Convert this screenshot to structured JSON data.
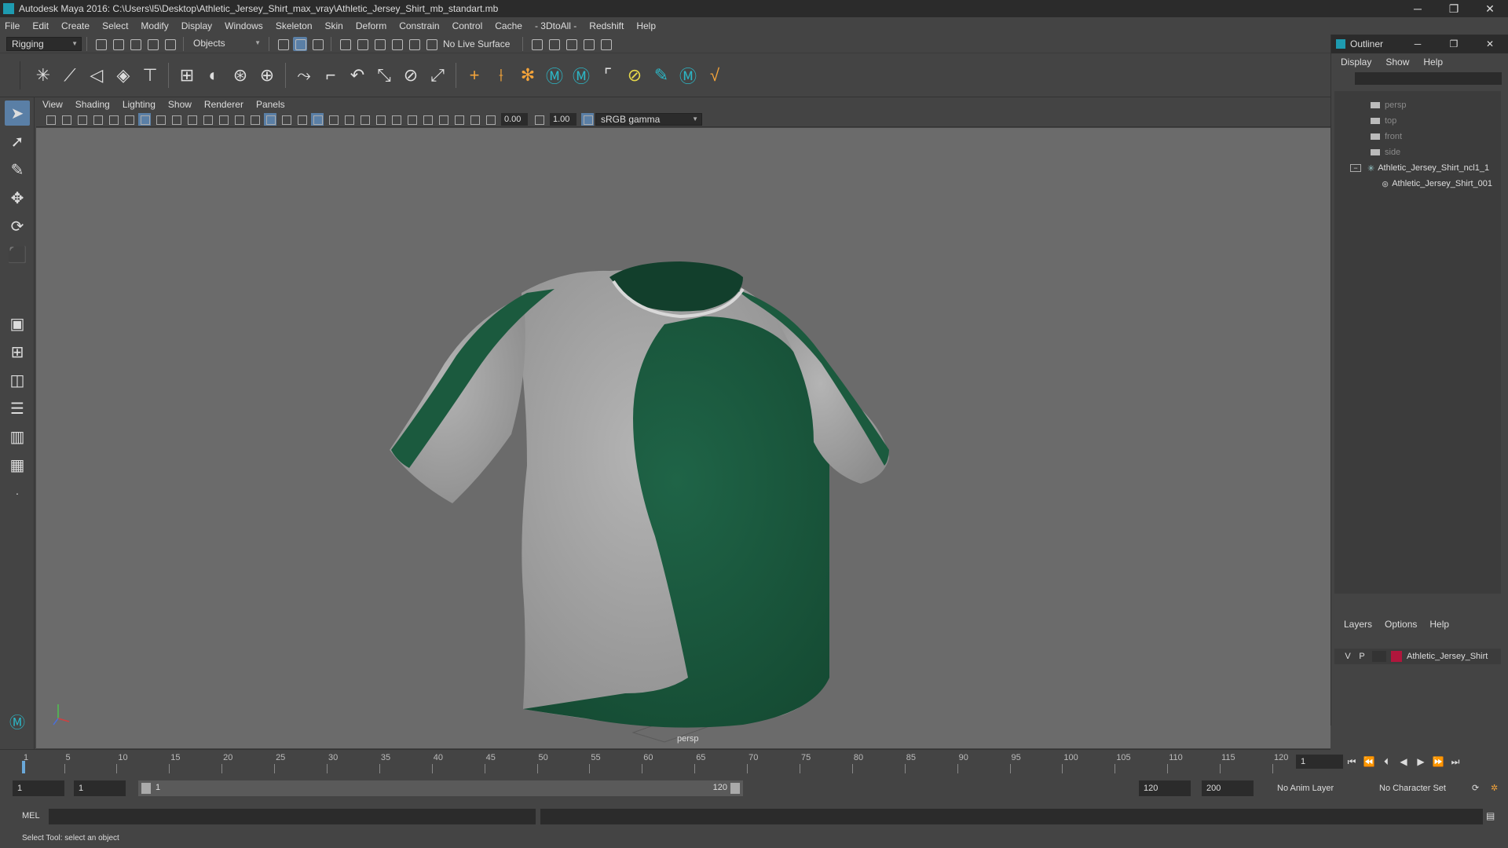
{
  "window": {
    "title": "Autodesk Maya 2016: C:\\Users\\l5\\Desktop\\Athletic_Jersey_Shirt_max_vray\\Athletic_Jersey_Shirt_mb_standart.mb",
    "minimize": "─",
    "restore": "❐",
    "close": "✕"
  },
  "menubar": [
    "File",
    "Edit",
    "Create",
    "Select",
    "Modify",
    "Display",
    "Windows",
    "Skeleton",
    "Skin",
    "Deform",
    "Constrain",
    "Control",
    "Cache",
    "- 3DtoAll -",
    "Redshift",
    "Help"
  ],
  "statusline": {
    "menuset": "Rigging",
    "selectmode": "Objects",
    "live_surface": "No Live Surface"
  },
  "panel": {
    "menu": [
      "View",
      "Shading",
      "Lighting",
      "Show",
      "Renderer",
      "Panels"
    ],
    "exposure": "0.00",
    "gamma": "1.00",
    "colorspace": "sRGB gamma",
    "camera_label": "persp"
  },
  "outliner": {
    "title": "Outliner",
    "menu": [
      "Display",
      "Show",
      "Help"
    ],
    "cameras": [
      "persp",
      "top",
      "front",
      "side"
    ],
    "group": "Athletic_Jersey_Shirt_ncl1_1",
    "child": "Athletic_Jersey_Shirt_001"
  },
  "layers": {
    "menu": [
      "Layers",
      "Options",
      "Help"
    ],
    "visible": "V",
    "playback": "P",
    "name": "Athletic_Jersey_Shirt",
    "color": "#b0163c"
  },
  "timeline": {
    "ticks": [
      "1",
      "5",
      "10",
      "15",
      "20",
      "25",
      "30",
      "35",
      "40",
      "45",
      "50",
      "55",
      "60",
      "65",
      "70",
      "75",
      "80",
      "85",
      "90",
      "95",
      "100",
      "105",
      "110",
      "115",
      "120"
    ],
    "current_frame": "1"
  },
  "range": {
    "start": "1",
    "playback_start": "1",
    "slider_start": "1",
    "slider_end": "120",
    "playback_end": "120",
    "end": "200",
    "anim_layer": "No Anim Layer",
    "char_set": "No Character Set"
  },
  "cmdline": {
    "lang": "MEL"
  },
  "help": {
    "text": "Select Tool: select an object"
  },
  "colors": {
    "jersey_green": "#1b5a3e",
    "jersey_grey": "#a8a8a8",
    "viewport_bg": "#6b6b6b",
    "accent": "#5a7fa6"
  }
}
